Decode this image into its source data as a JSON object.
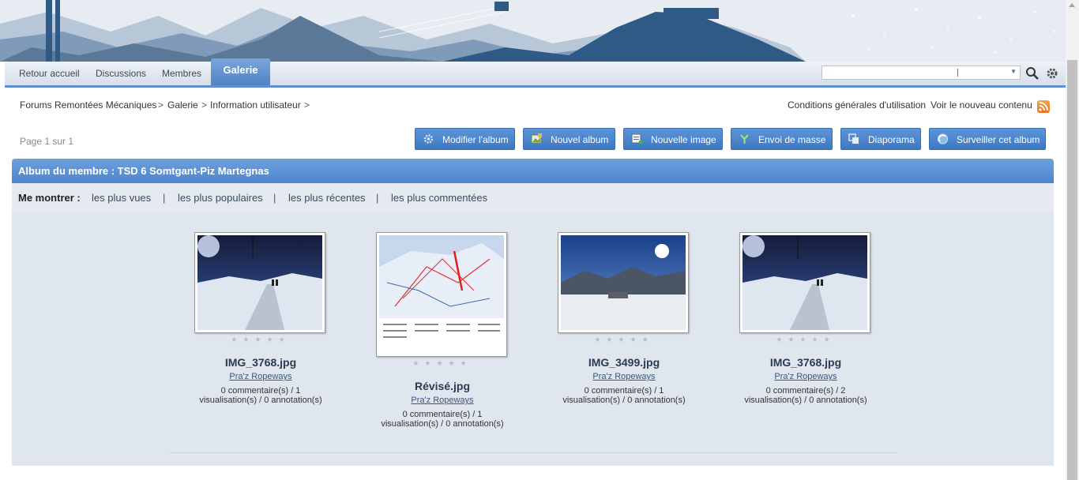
{
  "nav": {
    "items": [
      "Retour accueil",
      "Discussions",
      "Membres"
    ],
    "active": "Galerie"
  },
  "breadcrumb": [
    "Forums Remontées Mécaniques",
    "Galerie",
    "Information utilisateur"
  ],
  "breadcrumb_sep": ">",
  "top_links": {
    "terms": "Conditions générales d'utilisation",
    "new_content": "Voir le nouveau contenu"
  },
  "page_info": "Page 1 sur 1",
  "actions": [
    "Modifier l'album",
    "Nouvel album",
    "Nouvelle image",
    "Envoi de masse",
    "Diaporama",
    "Surveiller cet album"
  ],
  "album_title": "Album du membre : TSD 6 Somtgant-Piz Martegnas",
  "filter": {
    "label": "Me montrer :",
    "links": [
      "les plus vues",
      "les plus populaires",
      "les plus récentes",
      "les plus commentées"
    ],
    "sep": "|"
  },
  "images": [
    {
      "title": "IMG_3768.jpg",
      "author": "Pra'z Ropeways",
      "stats1": "0 commentaire(s) / 1",
      "stats2": "visualisation(s) / 0 annotation(s)"
    },
    {
      "title": "Révisé.jpg",
      "author": "Pra'z Ropeways",
      "stats1": "0 commentaire(s) / 1",
      "stats2": "visualisation(s) / 0 annotation(s)"
    },
    {
      "title": "IMG_3499.jpg",
      "author": "Pra'z Ropeways",
      "stats1": "0 commentaire(s) / 1",
      "stats2": "visualisation(s) / 0 annotation(s)"
    },
    {
      "title": "IMG_3768.jpg",
      "author": "Pra'z Ropeways",
      "stats1": "0 commentaire(s) / 2",
      "stats2": "visualisation(s) / 0 annotation(s)"
    }
  ],
  "stars": "★★★★★",
  "colors": {
    "accent": "#4f84c6",
    "header": "#5e90cf",
    "panel": "#dfe6ee"
  },
  "icons": {
    "search": "magnifier-icon",
    "settings": "gear-icon",
    "rss": "rss-icon"
  }
}
